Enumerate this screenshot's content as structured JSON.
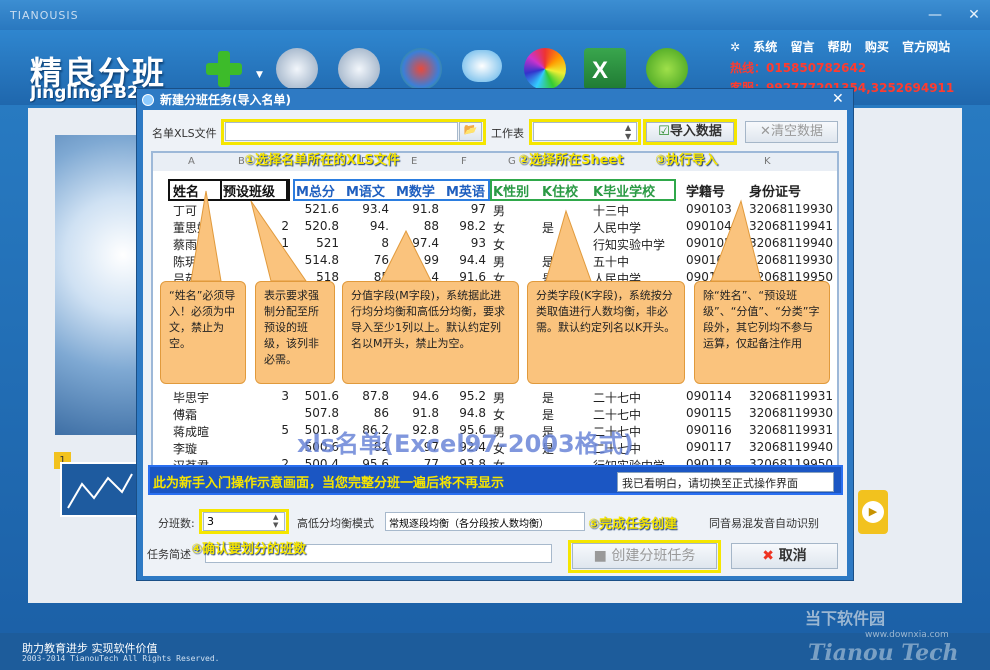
{
  "app": {
    "window_title": "TIANOUSIS",
    "brand_title": "精良分班",
    "brand_sub": "JinglingFB2012",
    "menu": [
      "系统",
      "留言",
      "帮助",
      "购买",
      "官方网站"
    ],
    "hotline": "热线：015850782642",
    "qq": "客服：992777201354,3252694911",
    "footer_slogan": "助力教育进步   实现软件价值",
    "footer_copyright": "2003-2014 TianouTech All Rights Reserved.",
    "watermark": "当下软件园",
    "watermark_url": "www.downxia.com",
    "watermark_brand": "Tianou Tech",
    "badge": "1"
  },
  "dialog": {
    "title": "新建分班任务(导入名单)",
    "file_label": "名单XLS文件",
    "sheet_label": "工作表",
    "import_label": "导入数据",
    "clear_label": "清空数据",
    "class_count_label": "分班数:",
    "class_count_value": "3",
    "balance_label": "高低分均衡模式",
    "balance_value": "常规逐段均衡（各分段按人数均衡）",
    "homophone_label": "同音易混发音自动识别",
    "desc_label": "任务简述",
    "create_label": "创建分班任务",
    "cancel_label": "取消"
  },
  "annotations": {
    "step1": "①选择名单所在的XLS文件",
    "step2": "②选择所在Sheet",
    "step3": "③执行导入",
    "step4": "④确认要划分的班数",
    "step5": "⑤完成任务创建",
    "xls_title": "xls名单(Excel97-2003格式)",
    "newbie_notice": "此为新手入门操作示意画面，当您完整分班一遍后将不再显示",
    "understood_button": "我已看明白，请切换至正式操作界面",
    "bubble_name": "“姓名”必须导入！必须为中文，禁止为空。",
    "bubble_preset": "表示要求强制分配至所预设的班级，该列非必需。",
    "bubble_score": "分值字段(M字段)，系统据此进行均分均衡和高低分均衡，要求导入至少1列以上。默认约定列名以M开头，禁止为空。",
    "bubble_class": "分类字段(K字段)，系统按分类取值进行人数均衡，非必需。默认约定列名以K开头。",
    "bubble_other": "除“姓名”、“预设班级”、“分值”、“分类”字段外，其它列均不参与运算，仅起备注作用"
  },
  "sheet": {
    "col_letters": [
      "A",
      "B",
      "C",
      "D",
      "E",
      "F",
      "G",
      "H",
      "I",
      "J",
      "K"
    ],
    "headers": [
      "姓名",
      "预设班级",
      "M总分",
      "M语文",
      "M数学",
      "M英语",
      "K性别",
      "K住校",
      "K毕业学校",
      "学籍号",
      "身份证号"
    ],
    "rows_top": [
      [
        "丁可",
        "",
        "521.6",
        "93.4",
        "91.8",
        "97",
        "男",
        "",
        "十三中",
        "090103",
        "32068119930"
      ],
      [
        "董思妍",
        "2",
        "520.8",
        "94.",
        "88",
        "98.2",
        "女",
        "是",
        "人民中学",
        "090104",
        "32068119941"
      ],
      [
        "蔡雨清",
        "1",
        "521",
        "8",
        "97.4",
        "93",
        "女",
        "",
        "行知实验中学",
        "090105",
        "32068119940"
      ],
      [
        "陈玥",
        "",
        "514.8",
        "76",
        "99",
        "94.4",
        "男",
        "是",
        "五十中",
        "090106",
        "32068119930"
      ],
      [
        "吕茹",
        "2",
        "518",
        "85",
        "94.4",
        "91.6",
        "女",
        "是",
        "人民中学",
        "090107",
        "32068119950"
      ]
    ],
    "rows_bottom": [
      [
        "毕思宇",
        "3",
        "501.6",
        "87.8",
        "94.6",
        "95.2",
        "男",
        "是",
        "二十七中",
        "090114",
        "32068119931"
      ],
      [
        "傅霜",
        "",
        "507.8",
        "86",
        "91.8",
        "94.8",
        "女",
        "是",
        "二十七中",
        "090115",
        "32068119930"
      ],
      [
        "蒋成暄",
        "5",
        "501.8",
        "86.2",
        "92.8",
        "95.6",
        "男",
        "是",
        "二十七中",
        "090116",
        "32068119931"
      ],
      [
        "李璇",
        "",
        "500.6",
        "82",
        "97",
        "92.4",
        "女",
        "是",
        "二十七中",
        "090117",
        "32068119940"
      ],
      [
        "汉茗君",
        "2",
        "500.4",
        "95.6",
        "77",
        "93.8",
        "女",
        "",
        "行知实验中学",
        "090118",
        "32068119950"
      ]
    ]
  },
  "colors": {
    "accent_yellow": "#f5e600",
    "bubble": "#fac37d",
    "titlebar": "#2a7fc6",
    "notice_bg": "#1b56c3"
  }
}
